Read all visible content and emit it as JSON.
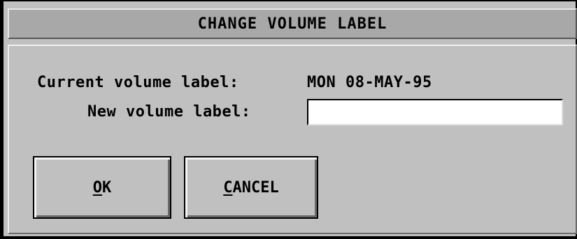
{
  "dialog": {
    "title": "CHANGE VOLUME LABEL"
  },
  "fields": {
    "current_label_caption": "Current volume label:",
    "current_label_value": "MON 08-MAY-95",
    "new_label_caption": "New volume label:",
    "new_label_value": "",
    "new_label_placeholder": ""
  },
  "buttons": {
    "ok": {
      "mnemonic": "O",
      "rest": "K"
    },
    "cancel": {
      "mnemonic": "C",
      "rest": "ANCEL"
    }
  },
  "colors": {
    "background": "#c0c0c0",
    "titlebar": "#a8a8a8",
    "input_background": "#ffffff",
    "text": "#000000"
  }
}
